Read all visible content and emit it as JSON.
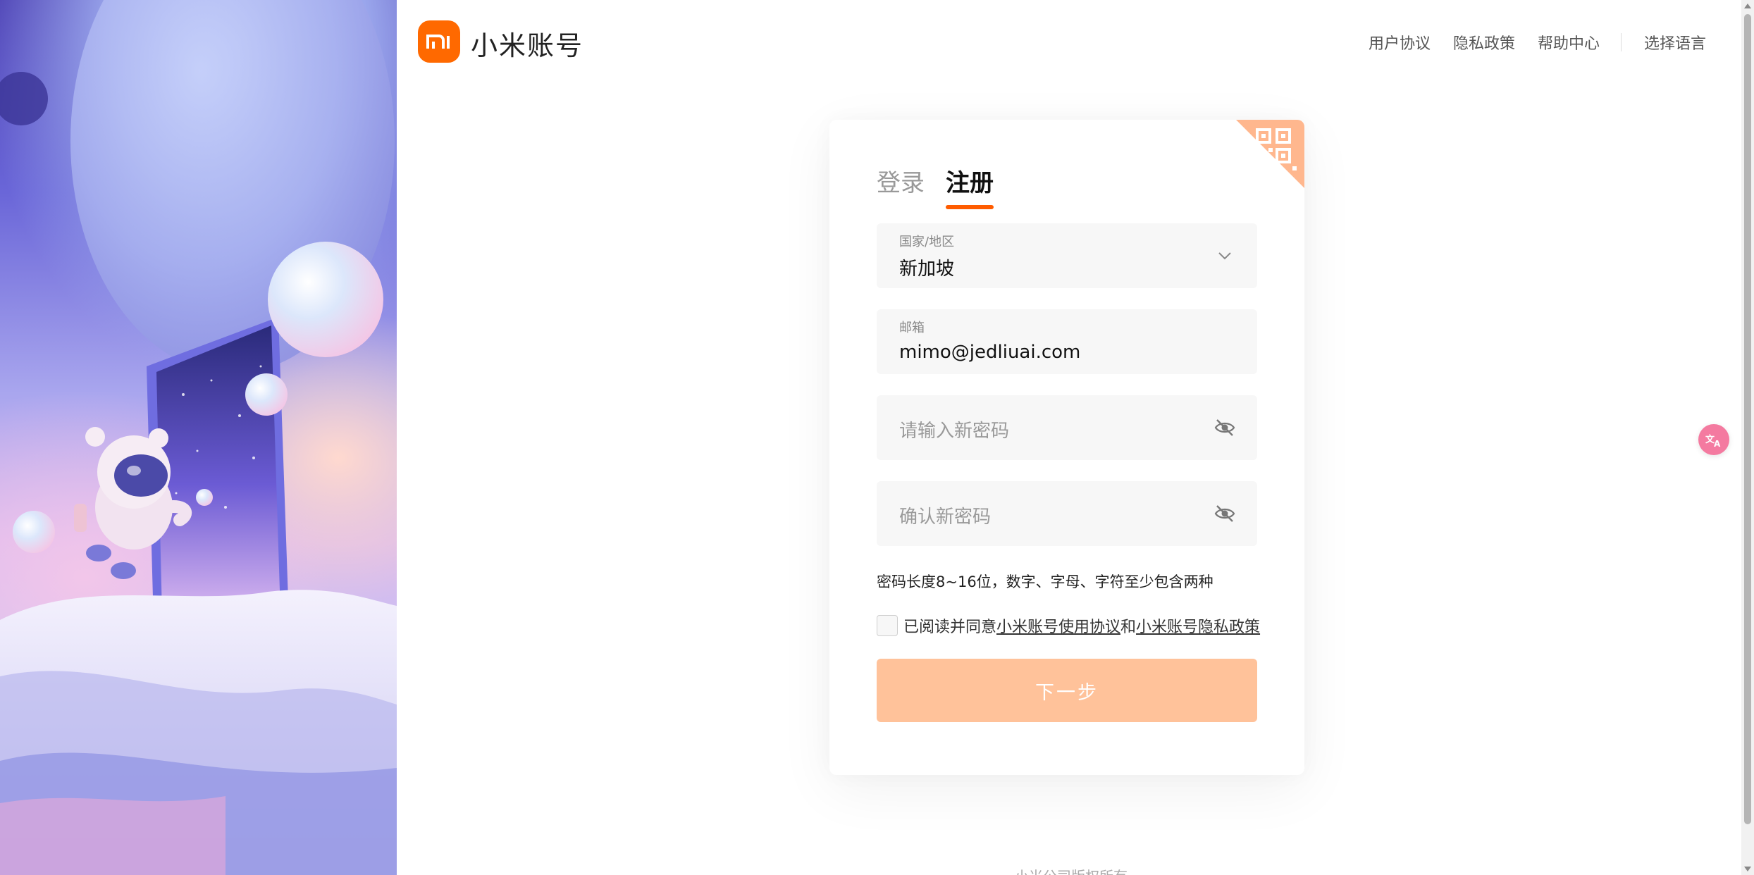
{
  "header": {
    "logo_text": "mi",
    "brand": "小米账号",
    "nav": {
      "agreement": "用户协议",
      "privacy": "隐私政策",
      "help": "帮助中心",
      "language": "选择语言"
    }
  },
  "card": {
    "tabs": {
      "login": "登录",
      "register": "注册",
      "active": "register"
    },
    "country": {
      "label": "国家/地区",
      "value": "新加坡"
    },
    "email": {
      "label": "邮箱",
      "value": "mimo@jedliuai.com"
    },
    "password": {
      "placeholder": "请输入新密码"
    },
    "confirm_password": {
      "placeholder": "确认新密码"
    },
    "hint": "密码长度8~16位，数字、字母、字符至少包含两种",
    "agree": {
      "prefix": "已阅读并同意",
      "terms_link": "小米账号使用协议",
      "and": "和",
      "privacy_link": "小米账号隐私政策",
      "checked": false
    },
    "next_button": "下一步"
  },
  "footer": {
    "copyright": "小米公司版权所有"
  },
  "colors": {
    "brand_orange": "#ff6900",
    "tab_underline": "#ff5c00",
    "button_disabled": "#ffc29a",
    "translate_fab": "#f47aa0"
  },
  "icons": [
    "mi-logo-icon",
    "qr-code-icon",
    "chevron-down-icon",
    "eye-hidden-icon",
    "translate-icon"
  ]
}
